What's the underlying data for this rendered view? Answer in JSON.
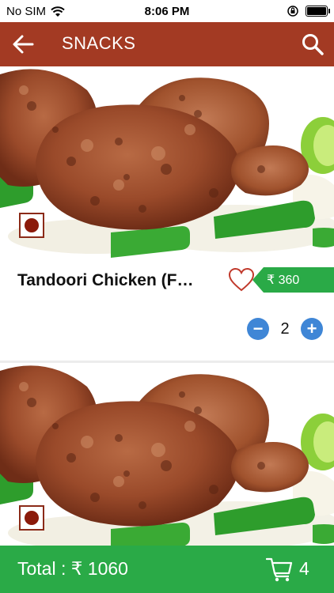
{
  "status_bar": {
    "carrier": "No SIM",
    "time": "8:06 PM",
    "battery_level": 1.0
  },
  "header": {
    "title": "SNACKS",
    "back_icon": "arrow-left-icon",
    "search_icon": "search-icon"
  },
  "items": [
    {
      "name": "Tandoori Chicken  (F…",
      "price": "₹ 360",
      "quantity": "2",
      "minus": "−",
      "plus": "+",
      "favorite_icon": "heart-outline-icon",
      "type_icon": "non-veg-icon"
    },
    {
      "type_icon": "non-veg-icon"
    }
  ],
  "footer": {
    "total": "Total : ₹ 1060",
    "cart_count": "4",
    "cart_icon": "cart-icon"
  },
  "colors": {
    "app_bar": "#a33a23",
    "accent_green": "#2aaa47",
    "qty_blue": "#3f86d6"
  }
}
